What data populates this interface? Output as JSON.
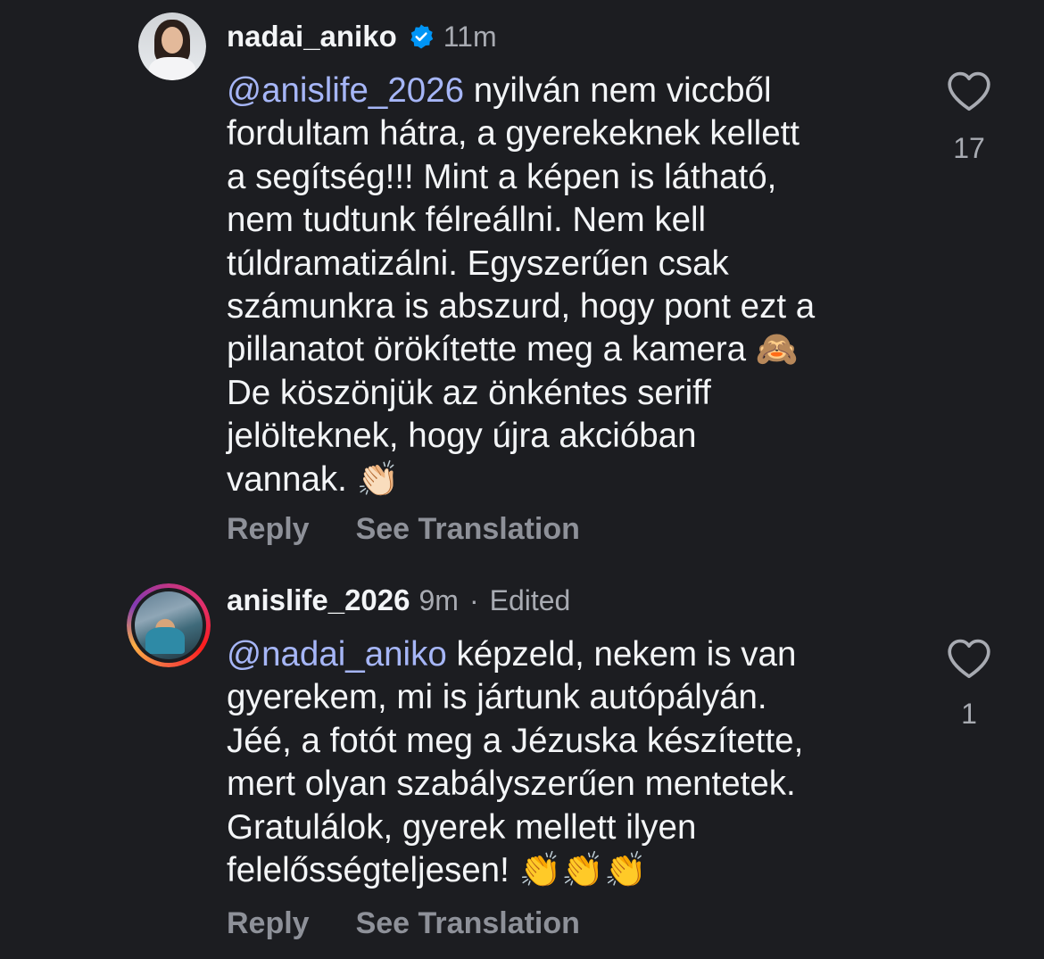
{
  "comments": [
    {
      "username": "nadai_aniko",
      "verified": true,
      "time": "11m",
      "mention": "@anislife_2026",
      "text_parts": [
        " nyilván nem viccből\nfordultam hátra, a gyerekeknek kellett\na segítség!!! Mint a képen is látható,\nnem tudtunk félreállni. Nem kell\ntúldramatizálni. Egyszerűen csak\nszámunkra is abszurd, hogy pont ezt a\npillanatot örökítette meg a kamera ",
        "🙈",
        "\nDe köszönjük az önkéntes seriff\njelölteknek, hogy újra akcióban\nvannak. ",
        "👏🏻"
      ],
      "like_count": "17",
      "reply_label": "Reply",
      "translation_label": "See Translation"
    },
    {
      "username": "anislife_2026",
      "time": "9m",
      "separator": "·",
      "edited": "Edited",
      "mention": "@nadai_aniko",
      "text_parts": [
        " képzeld, nekem is van\ngyerekem, mi is jártunk autópályán.\nJéé, a fotót meg a Jézuska készítette,\nmert olyan szabályszerűen mentetek.\nGratulálok, gyerek mellett ilyen\nfelelősségteljesen! ",
        "👏👏👏"
      ],
      "like_count": "1",
      "reply_label": "Reply",
      "translation_label": "See Translation"
    }
  ],
  "colors": {
    "background": "#1c1d21",
    "text": "#f3f5f7",
    "mention": "#a6b6f7",
    "muted": "#a8abb2",
    "action": "#8e9199",
    "verified": "#0095f6"
  },
  "icons": {
    "verified": "verified-badge-icon",
    "like": "heart-outline-icon"
  }
}
